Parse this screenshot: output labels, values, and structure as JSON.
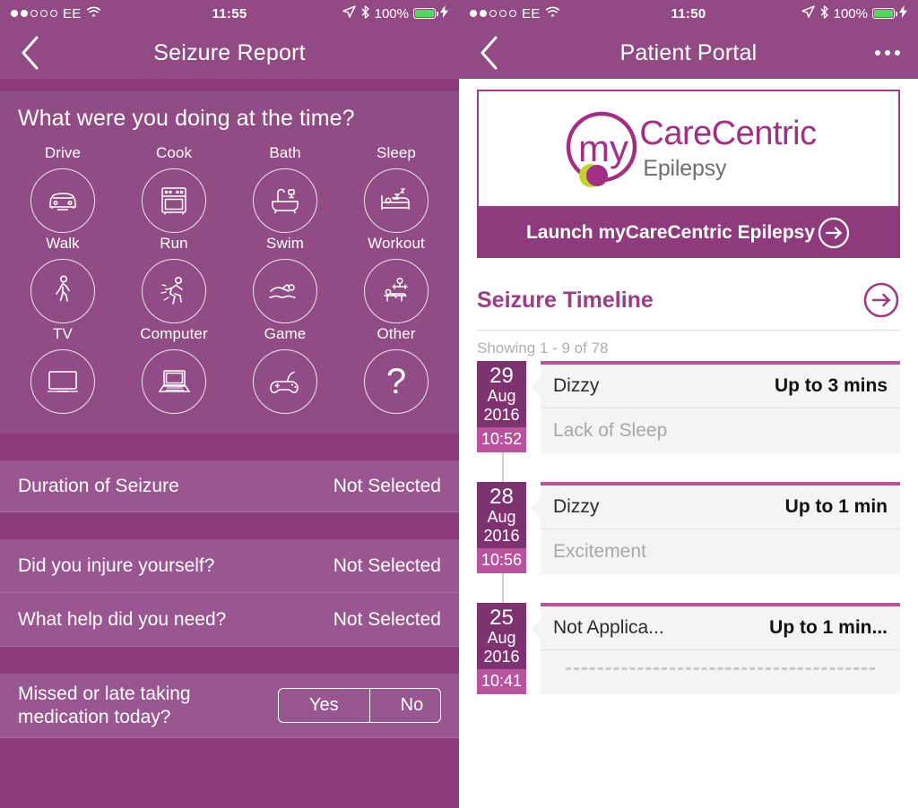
{
  "left": {
    "status_bar": {
      "carrier": "EE",
      "time": "11:55",
      "battery_percent": "100%",
      "signal_dots_filled": 2,
      "signal_dots_total": 5
    },
    "nav": {
      "title": "Seizure Report",
      "back_icon": "chevron-left-icon"
    },
    "question": "What were you doing at the time?",
    "activities": [
      {
        "label": "Drive",
        "icon": "car-icon"
      },
      {
        "label": "Cook",
        "icon": "oven-icon"
      },
      {
        "label": "Bath",
        "icon": "bathtub-icon"
      },
      {
        "label": "Sleep",
        "icon": "bed-sleep-icon"
      },
      {
        "label": "Walk",
        "icon": "walking-person-icon"
      },
      {
        "label": "Run",
        "icon": "running-person-icon"
      },
      {
        "label": "Swim",
        "icon": "swimmer-icon"
      },
      {
        "label": "Workout",
        "icon": "bench-press-icon"
      },
      {
        "label": "TV",
        "icon": "television-icon"
      },
      {
        "label": "Computer",
        "icon": "laptop-icon"
      },
      {
        "label": "Game",
        "icon": "gamepad-icon"
      },
      {
        "label": "Other",
        "icon": "question-mark-icon"
      }
    ],
    "rows": [
      {
        "question": "Duration of Seizure",
        "value": "Not Selected"
      },
      {
        "question": "Did you injure yourself?",
        "value": "Not Selected"
      },
      {
        "question": "What help did you need?",
        "value": "Not Selected"
      }
    ],
    "medication_row": {
      "question": "Missed or late taking medication today?",
      "yes_label": "Yes",
      "no_label": "No"
    }
  },
  "right": {
    "status_bar": {
      "carrier": "EE",
      "time": "11:50",
      "battery_percent": "100%",
      "signal_dots_filled": 2,
      "signal_dots_total": 5
    },
    "nav": {
      "title": "Patient Portal",
      "back_icon": "chevron-left-icon",
      "more_icon": "ellipsis-icon"
    },
    "promo": {
      "logo_primary": "CareCentric",
      "logo_prefix": "my",
      "logo_secondary": "Epilepsy",
      "cta_label": "Launch myCareCentric Epilepsy",
      "cta_icon": "arrow-right-circle-icon"
    },
    "timeline": {
      "title": "Seizure Timeline",
      "arrow_icon": "arrow-right-circle-icon",
      "showing": "Showing 1 - 9 of 78",
      "entries": [
        {
          "day": "29",
          "month": "Aug",
          "year": "2016",
          "time": "10:52",
          "type": "Dizzy",
          "duration": "Up to 3 mins",
          "trigger": "Lack of Sleep",
          "dashed": false
        },
        {
          "day": "28",
          "month": "Aug",
          "year": "2016",
          "time": "10:56",
          "type": "Dizzy",
          "duration": "Up to 1 min",
          "trigger": "Excitement",
          "dashed": false
        },
        {
          "day": "25",
          "month": "Aug",
          "year": "2016",
          "time": "10:41",
          "type": "Not Applica...",
          "duration": "Up to 1 min...",
          "trigger": "",
          "dashed": true
        }
      ]
    }
  },
  "colors": {
    "nav_purple": "#924A84",
    "activity_purple": "#914B85",
    "band_purple": "#8D3A7C",
    "row_purple": "#9A5690",
    "brand_magenta": "#9C3C86",
    "logo_purple": "#A32E86",
    "logo_grey": "#6B6F74",
    "logo_lime": "#C4D42E",
    "date_purple": "#7E3370",
    "time_magenta": "#B8549E",
    "card_grey": "#F4F4F4",
    "battery_green": "#4CD964"
  }
}
